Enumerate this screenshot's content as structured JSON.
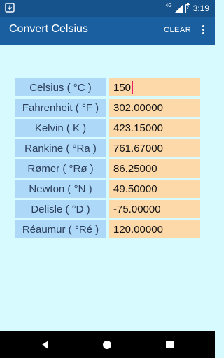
{
  "status": {
    "network": "4G",
    "time": "3:19"
  },
  "appbar": {
    "title": "Convert Celsius",
    "clear_label": "CLEAR"
  },
  "units": [
    {
      "label": "Celsius ( °C )",
      "value": "150"
    },
    {
      "label": "Fahrenheit ( °F )",
      "value": "302.00000"
    },
    {
      "label": "Kelvin ( K )",
      "value": "423.15000"
    },
    {
      "label": "Rankine ( °Ra )",
      "value": "761.67000"
    },
    {
      "label": "Rømer ( °Rø )",
      "value": "86.25000"
    },
    {
      "label": "Newton ( °N )",
      "value": "49.50000"
    },
    {
      "label": "Delisle ( °D )",
      "value": "-75.00000"
    },
    {
      "label": "Réaumur ( °Ré )",
      "value": "120.00000"
    }
  ],
  "colors": {
    "status_bar": "#16528c",
    "app_bar": "#1a5fa0",
    "background": "#d6fafd",
    "label_bg": "#aed8f7",
    "value_bg": "#fdd8a8",
    "cursor": "#e91e63"
  }
}
